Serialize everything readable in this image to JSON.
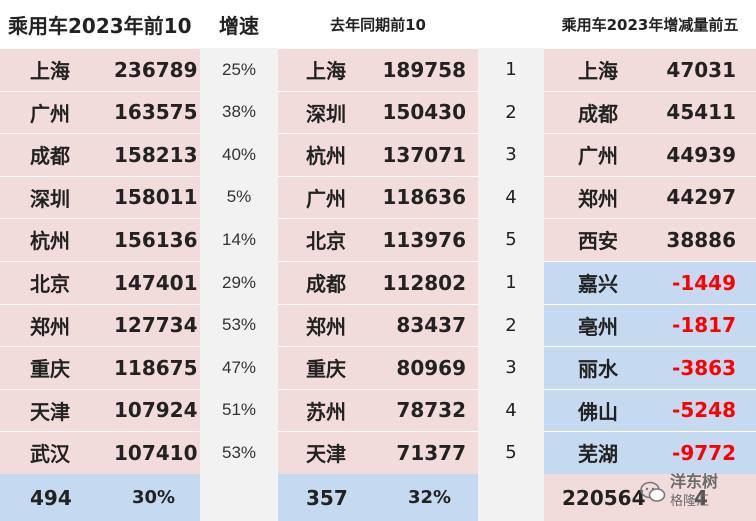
{
  "headers": {
    "col1": "乘用车2023年前10",
    "col2": "增速",
    "col3": "去年同期前10",
    "col4": "乘用车2023年增减量前五"
  },
  "left_rows": [
    {
      "city": "上海",
      "value": "236789",
      "growth": "25%"
    },
    {
      "city": "广州",
      "value": "163575",
      "growth": "38%"
    },
    {
      "city": "成都",
      "value": "158213",
      "growth": "40%"
    },
    {
      "city": "深圳",
      "value": "158011",
      "growth": "5%"
    },
    {
      "city": "杭州",
      "value": "156136",
      "growth": "14%"
    },
    {
      "city": "北京",
      "value": "147401",
      "growth": "29%"
    },
    {
      "city": "郑州",
      "value": "127734",
      "growth": "53%"
    },
    {
      "city": "重庆",
      "value": "118675",
      "growth": "47%"
    },
    {
      "city": "天津",
      "value": "107924",
      "growth": "51%"
    },
    {
      "city": "武汉",
      "value": "107410",
      "growth": "53%"
    }
  ],
  "mid_rows": [
    {
      "city": "上海",
      "value": "189758"
    },
    {
      "city": "深圳",
      "value": "150430"
    },
    {
      "city": "杭州",
      "value": "137071"
    },
    {
      "city": "广州",
      "value": "118636"
    },
    {
      "city": "北京",
      "value": "113976"
    },
    {
      "city": "成都",
      "value": "112802"
    },
    {
      "city": "郑州",
      "value": "83437"
    },
    {
      "city": "重庆",
      "value": "80969"
    },
    {
      "city": "苏州",
      "value": "78732"
    },
    {
      "city": "天津",
      "value": "71377"
    }
  ],
  "ranks": [
    "1",
    "2",
    "3",
    "4",
    "5",
    "1",
    "2",
    "3",
    "4",
    "5"
  ],
  "right_rows": [
    {
      "city": "上海",
      "value": "47031"
    },
    {
      "city": "成都",
      "value": "45411"
    },
    {
      "city": "广州",
      "value": "44939"
    },
    {
      "city": "郑州",
      "value": "44297"
    },
    {
      "city": "西安",
      "value": "38886"
    },
    {
      "city": "嘉兴",
      "value": "-1449"
    },
    {
      "city": "亳州",
      "value": "-1817"
    },
    {
      "city": "丽水",
      "value": "-3863"
    },
    {
      "city": "佛山",
      "value": "-5248"
    },
    {
      "city": "芜湖",
      "value": "-9772"
    }
  ],
  "totals": {
    "left_value": "494",
    "left_pct": "30%",
    "mid_value": "357",
    "mid_pct": "32%",
    "right_value": "220564",
    "right_suffix": "4"
  },
  "watermark": {
    "line1": "洋东树",
    "line2": "格隆汇"
  },
  "colors": {
    "pink": "#f2dcdb",
    "blue": "#c5d9f1",
    "negative": "#ff0000"
  }
}
